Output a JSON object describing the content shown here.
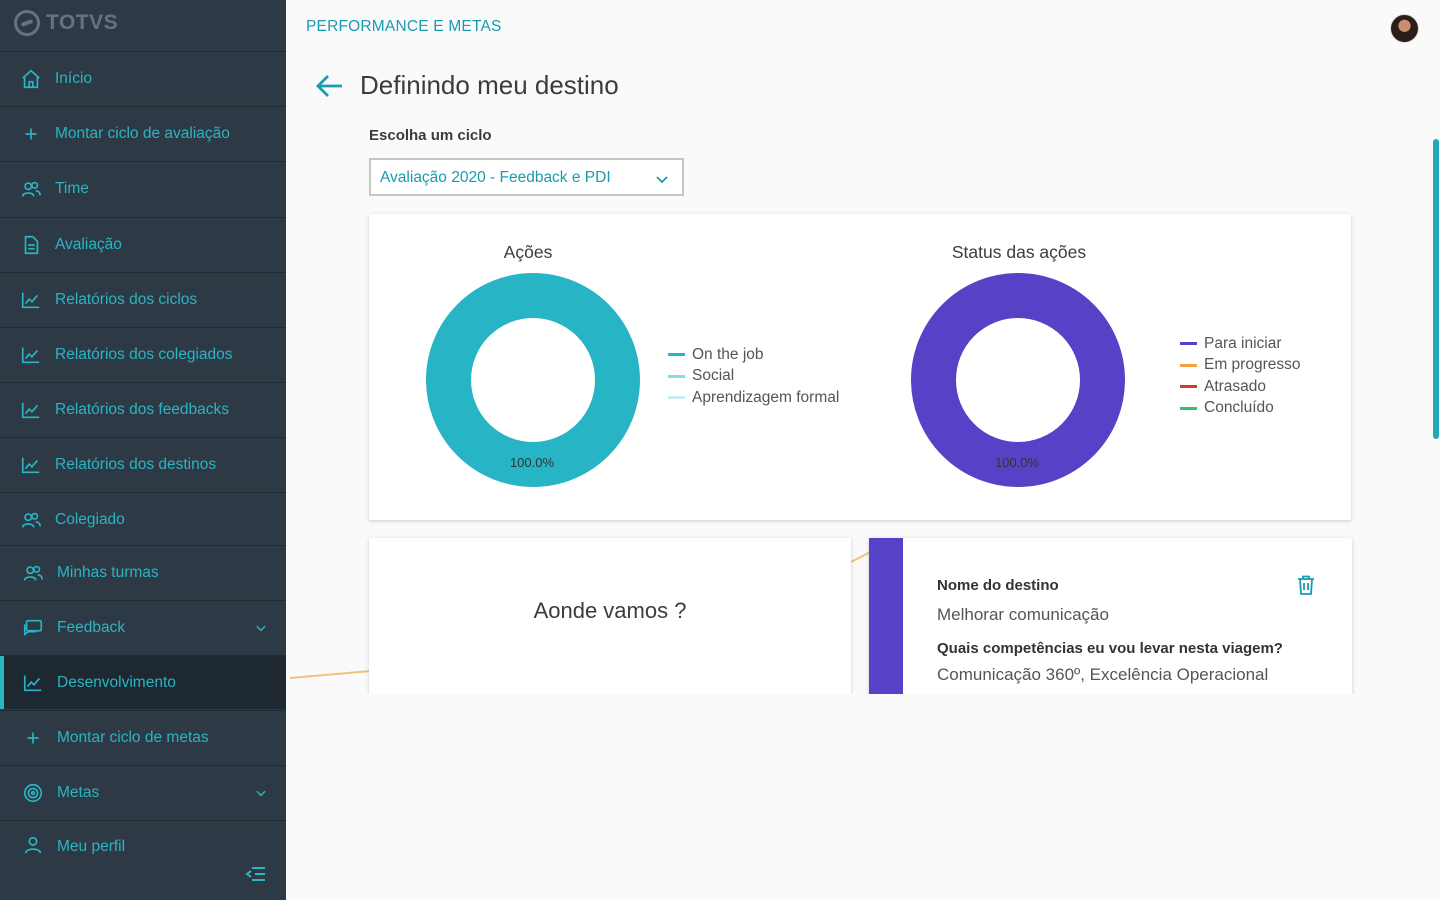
{
  "brand": {
    "logo_text": "TOTVS"
  },
  "header": {
    "title": "PERFORMANCE E METAS"
  },
  "page": {
    "title": "Definindo meu destino"
  },
  "cycle": {
    "label": "Escolha um ciclo",
    "selected": "Avaliação 2020 - Feedback e PDI"
  },
  "sidebar": {
    "items": [
      {
        "label": "Início",
        "icon": "home-icon"
      },
      {
        "label": "Montar ciclo de avaliação",
        "icon": "plus-icon"
      },
      {
        "label": "Time",
        "icon": "users-icon"
      },
      {
        "label": "Avaliação",
        "icon": "document-icon"
      },
      {
        "label": "Relatórios dos ciclos",
        "icon": "chart-icon"
      },
      {
        "label": "Relatórios dos colegiados",
        "icon": "chart-icon"
      },
      {
        "label": "Relatórios dos feedbacks",
        "icon": "chart-icon"
      },
      {
        "label": "Relatórios dos destinos",
        "icon": "chart-icon"
      },
      {
        "label": "Colegiado",
        "icon": "users-icon"
      },
      {
        "label": "Minhas turmas",
        "icon": "users-icon"
      },
      {
        "label": "Feedback",
        "icon": "chat-icon"
      },
      {
        "label": "Desenvolvimento",
        "icon": "chart-icon"
      },
      {
        "label": "Montar ciclo de metas",
        "icon": "plus-icon"
      },
      {
        "label": "Metas",
        "icon": "target-icon"
      },
      {
        "label": "Meu perfil",
        "icon": "user-icon"
      }
    ]
  },
  "chart_data": [
    {
      "type": "pie",
      "title": "Ações",
      "donut": true,
      "categories": [
        "On the job",
        "Social",
        "Aprendizagem formal"
      ],
      "values": [
        100,
        0,
        0
      ],
      "colors": [
        "#27b4c4",
        "#86dce4",
        "#c5eef2"
      ],
      "labels": [
        "100.0%"
      ],
      "legend_position": "right"
    },
    {
      "type": "pie",
      "title": "Status das ações",
      "donut": true,
      "categories": [
        "Para iniciar",
        "Em progresso",
        "Atrasado",
        "Concluído"
      ],
      "values": [
        100,
        0,
        0,
        0
      ],
      "colors": [
        "#5642c6",
        "#f2a23c",
        "#d63a2f",
        "#3bbf5c"
      ],
      "labels": [
        "100.0%"
      ],
      "legend_position": "right"
    }
  ],
  "where": {
    "title": "Aonde vamos ?"
  },
  "destination": {
    "name_label": "Nome do destino",
    "name_value": "Melhorar comunicação",
    "question": "Quais competências eu vou levar nesta viagem?",
    "answer": "Comunicação 360º, Excelência Operacional"
  },
  "colors": {
    "accent": "#1a9bb0",
    "sidebar_bg": "#2d3a45",
    "purple": "#5642c6",
    "teal": "#27b4c4"
  }
}
